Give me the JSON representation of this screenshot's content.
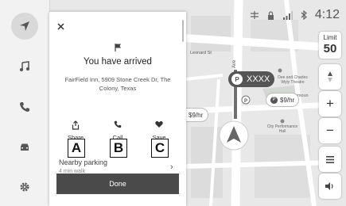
{
  "map": {
    "streets": [
      "Leonard St",
      "Ave"
    ],
    "places": [
      {
        "name": "Dee and Charles Wyly Theatre"
      },
      {
        "name": "City Performance Hall"
      }
    ],
    "fragments": [
      "rmoun"
    ],
    "pin_label": "XXXX",
    "price_tag_1": "$9/hr",
    "price_tag_2": "$9/hr"
  },
  "status_bar": {
    "time": "4:12"
  },
  "speed_limit": {
    "label": "Limit",
    "value": "50"
  },
  "controls": {
    "zoom_in": "+",
    "zoom_out": "−"
  },
  "panel": {
    "title": "You have arrived",
    "address": "FairField Inn, 5909 Stone Creek Dr, The Colony, Texas",
    "actions": [
      {
        "label": "Share",
        "callout": "A"
      },
      {
        "label": "Call",
        "callout": "B"
      },
      {
        "label": "Save",
        "callout": "C"
      }
    ],
    "nearby": {
      "label": "Nearby parking",
      "walk": "4 min walk"
    },
    "done_label": "Done"
  }
}
